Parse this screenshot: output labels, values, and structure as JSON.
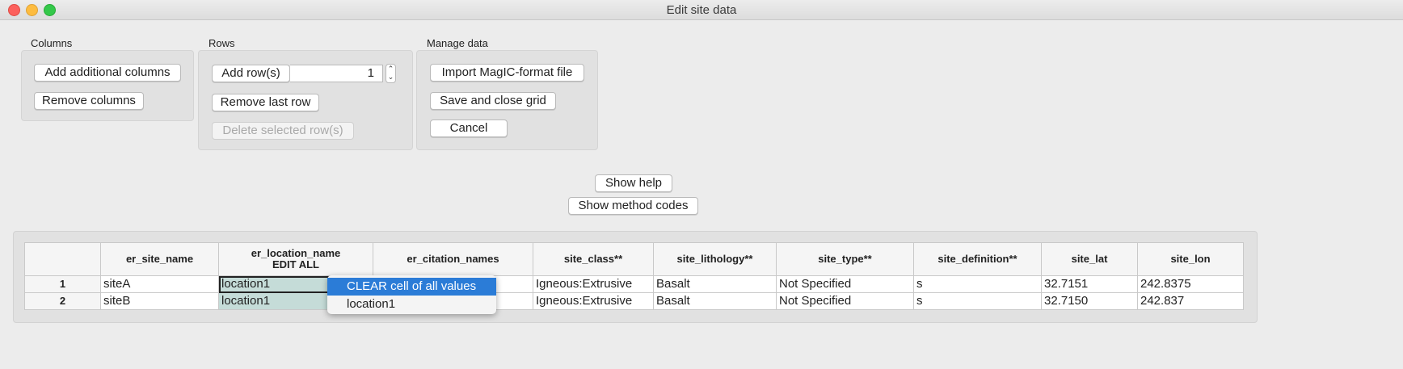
{
  "window": {
    "title": "Edit site data"
  },
  "columns_group": {
    "label": "Columns",
    "add_label": "Add additional columns",
    "remove_label": "Remove columns"
  },
  "rows_group": {
    "label": "Rows",
    "add_label": "Add row(s)",
    "add_count": "1",
    "remove_last_label": "Remove last row",
    "delete_selected_label": "Delete selected row(s)"
  },
  "manage_group": {
    "label": "Manage data",
    "import_label": "Import MagIC-format file",
    "save_label": "Save and close grid",
    "cancel_label": "Cancel"
  },
  "help": {
    "show_help_label": "Show help",
    "show_method_codes_label": "Show method codes"
  },
  "grid": {
    "headers": [
      {
        "line1": "",
        "line2": ""
      },
      {
        "line1": "er_site_name",
        "line2": ""
      },
      {
        "line1": "er_location_name",
        "line2": "EDIT ALL"
      },
      {
        "line1": "er_citation_names",
        "line2": ""
      },
      {
        "line1": "site_class**",
        "line2": ""
      },
      {
        "line1": "site_lithology**",
        "line2": ""
      },
      {
        "line1": "site_type**",
        "line2": ""
      },
      {
        "line1": "site_definition**",
        "line2": ""
      },
      {
        "line1": "site_lat",
        "line2": ""
      },
      {
        "line1": "site_lon",
        "line2": ""
      }
    ],
    "rows": [
      [
        "1",
        "siteA",
        "location1",
        "",
        "Igneous:Extrusive",
        "Basalt",
        "Not Specified",
        "s",
        "32.7151",
        "242.8375"
      ],
      [
        "2",
        "siteB",
        "location1",
        "",
        "Igneous:Extrusive",
        "Basalt",
        "Not Specified",
        "s",
        "32.7150",
        "242.837"
      ]
    ]
  },
  "context_menu": {
    "items": [
      "CLEAR cell of all values",
      "location1"
    ],
    "highlighted_color": "#2b7cd7"
  }
}
